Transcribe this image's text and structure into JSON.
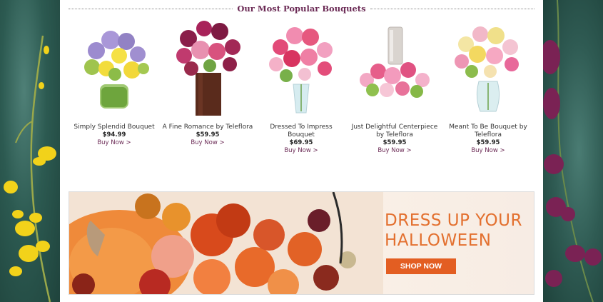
{
  "section": {
    "title": "Our Most Popular Bouquets"
  },
  "products": [
    {
      "name": "Simply Splendid Bouquet",
      "price": "$94.99",
      "buy_label": "Buy Now >"
    },
    {
      "name": "A Fine Romance by Teleflora",
      "price": "$59.95",
      "buy_label": "Buy Now >"
    },
    {
      "name": "Dressed To Impress Bouquet",
      "price": "$69.95",
      "buy_label": "Buy Now >"
    },
    {
      "name": "Just Delightful Centerpiece by Teleflora",
      "price": "$59.95",
      "buy_label": "Buy Now >"
    },
    {
      "name": "Meant To Be Bouquet by Teleflora",
      "price": "$59.95",
      "buy_label": "Buy Now >"
    }
  ],
  "banner": {
    "headline": "DRESS UP YOUR HALLOWEEN",
    "button_label": "SHOP NOW"
  },
  "colors": {
    "accent": "#6b2a55",
    "banner_orange": "#e3702f",
    "button": "#e35e22",
    "side_background": "#2f5a52"
  }
}
